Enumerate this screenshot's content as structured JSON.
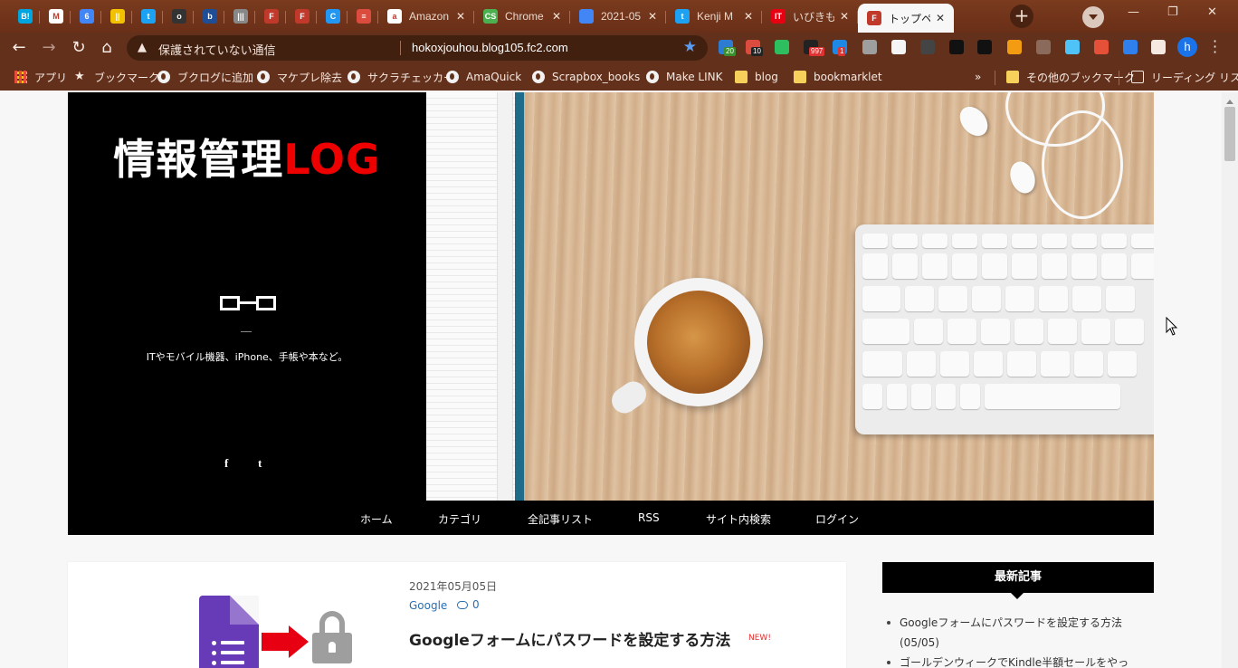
{
  "browser": {
    "tabs": [
      {
        "favicon": "hatena-bookmark-icon",
        "color": "#00a4de",
        "glyph": "B!",
        "title": ""
      },
      {
        "favicon": "gmail-icon",
        "color": "#ffffff",
        "glyph": "M",
        "title": ""
      },
      {
        "favicon": "calendar-icon",
        "color": "#4285f4",
        "glyph": "6",
        "title": ""
      },
      {
        "favicon": "notes-icon",
        "color": "#f2c200",
        "glyph": "||",
        "title": ""
      },
      {
        "favicon": "twitter-icon",
        "color": "#1da1f2",
        "glyph": "t",
        "title": ""
      },
      {
        "favicon": "owl-icon",
        "color": "#333333",
        "glyph": "o",
        "title": ""
      },
      {
        "favicon": "blog-icon",
        "color": "#1f4e96",
        "glyph": "b",
        "title": ""
      },
      {
        "favicon": "book-icon",
        "color": "#888888",
        "glyph": "|||",
        "title": ""
      },
      {
        "favicon": "fc2-icon",
        "color": "#c0392b",
        "glyph": "F",
        "title": ""
      },
      {
        "favicon": "fc2-icon",
        "color": "#c0392b",
        "glyph": "F",
        "title": ""
      },
      {
        "favicon": "c-icon",
        "color": "#2196f3",
        "glyph": "C",
        "title": ""
      },
      {
        "favicon": "todoist-icon",
        "color": "#db4c3f",
        "glyph": "≡",
        "title": ""
      },
      {
        "favicon": "amazon-icon",
        "color": "#ffffff",
        "glyph": "a",
        "title": "Amazon"
      },
      {
        "favicon": "chrome-store-icon",
        "color": "#4caf50",
        "glyph": "CS",
        "title": "Chrome"
      },
      {
        "favicon": "calendar-icon",
        "color": "#4285f4",
        "glyph": "",
        "title": "2021-05"
      },
      {
        "favicon": "twitter-icon",
        "color": "#1da1f2",
        "glyph": "t",
        "title": "Kenji M"
      },
      {
        "favicon": "itmedia-icon",
        "color": "#e60012",
        "glyph": "IT",
        "title": "いびきも"
      },
      {
        "favicon": "fc2-icon",
        "color": "#c0392b",
        "glyph": "F",
        "title": "トップペ"
      }
    ],
    "new_tab_symbol": "+",
    "window_controls": [
      "—",
      "❐",
      "✕"
    ],
    "address": {
      "security_text": "保護されていない通信",
      "url": "hokoxjouhou.blog105.fc2.com"
    },
    "extensions": [
      {
        "name": "pinboard-ext-icon",
        "color": "#2d7cd1",
        "badge": "20",
        "badge_color": "#3b8e2e"
      },
      {
        "name": "todoist-ext-icon",
        "color": "#db4c3f",
        "badge": "10",
        "badge_color": "#222222"
      },
      {
        "name": "evernote-ext-icon",
        "color": "#2dbe60",
        "badge": "",
        "badge_color": ""
      },
      {
        "name": "hatena-ext-icon",
        "color": "#222222",
        "badge": "997",
        "badge_color": "#d33"
      },
      {
        "name": "inoreader-ext-icon",
        "color": "#1e88e5",
        "badge": "1",
        "badge_color": "#d33"
      },
      {
        "name": "circle-ext-icon",
        "color": "#9e9e9e",
        "badge": "",
        "badge_color": ""
      },
      {
        "name": "calendar-ext-icon",
        "color": "#f5f5f5",
        "badge": "",
        "badge_color": ""
      },
      {
        "name": "grid-ext-icon",
        "color": "#444444",
        "badge": "",
        "badge_color": ""
      },
      {
        "name": "layers-ext-icon",
        "color": "#111111",
        "badge": "",
        "badge_color": ""
      },
      {
        "name": "drop-ext-icon",
        "color": "#111111",
        "badge": "",
        "badge_color": ""
      },
      {
        "name": "rss-ext-icon",
        "color": "#f39c12",
        "badge": "",
        "badge_color": ""
      },
      {
        "name": "share-ext-icon",
        "color": "#8a6a5a",
        "badge": "",
        "badge_color": ""
      },
      {
        "name": "diamond-ext-icon",
        "color": "#4fc3f7",
        "badge": "",
        "badge_color": ""
      },
      {
        "name": "castle-ext-icon",
        "color": "#e55039",
        "badge": "",
        "badge_color": ""
      },
      {
        "name": "expand-ext-icon",
        "color": "#2f80ed",
        "badge": "",
        "badge_color": ""
      },
      {
        "name": "puzzle-ext-icon",
        "color": "#f5e9e1",
        "badge": "",
        "badge_color": ""
      }
    ],
    "profile_initial": "h",
    "bookmarks": [
      {
        "label": "アプリ",
        "icon": "apps-grid-icon"
      },
      {
        "label": "ブックマーク",
        "icon": "star-icon"
      },
      {
        "label": "ブクログに追加",
        "icon": "globe-icon"
      },
      {
        "label": "マケプレ除去",
        "icon": "globe-icon"
      },
      {
        "label": "サクラチェッカー",
        "icon": "globe-icon"
      },
      {
        "label": "AmaQuick",
        "icon": "globe-icon"
      },
      {
        "label": "Scrapbox_books",
        "icon": "globe-icon"
      },
      {
        "label": "Make LINK",
        "icon": "globe-icon"
      },
      {
        "label": "blog",
        "icon": "folder-icon"
      },
      {
        "label": "bookmarklet",
        "icon": "folder-icon"
      }
    ],
    "bookmarks_overflow": "»",
    "other_bookmarks": "その他のブックマーク",
    "reading_list": "リーディング リスト"
  },
  "site": {
    "title_main": "情報管理",
    "title_accent": "LOG",
    "tagline": "ITやモバイル機器、iPhone、手帳や本など。",
    "social": [
      "f",
      "t"
    ],
    "nav": [
      "ホーム",
      "カテゴリ",
      "全記事リスト",
      "RSS",
      "サイト内検索",
      "ログイン"
    ]
  },
  "post": {
    "date": "2021年05月05日",
    "category": "Google",
    "comments": "0",
    "title": "Googleフォームにパスワードを設定する方法",
    "badge": "NEW!"
  },
  "sidebar": {
    "heading": "最新記事",
    "items": [
      "Googleフォームにパスワードを設定する方法",
      "(05/05)",
      "ゴールデンウィークでKindle半額セールをやっ"
    ]
  }
}
